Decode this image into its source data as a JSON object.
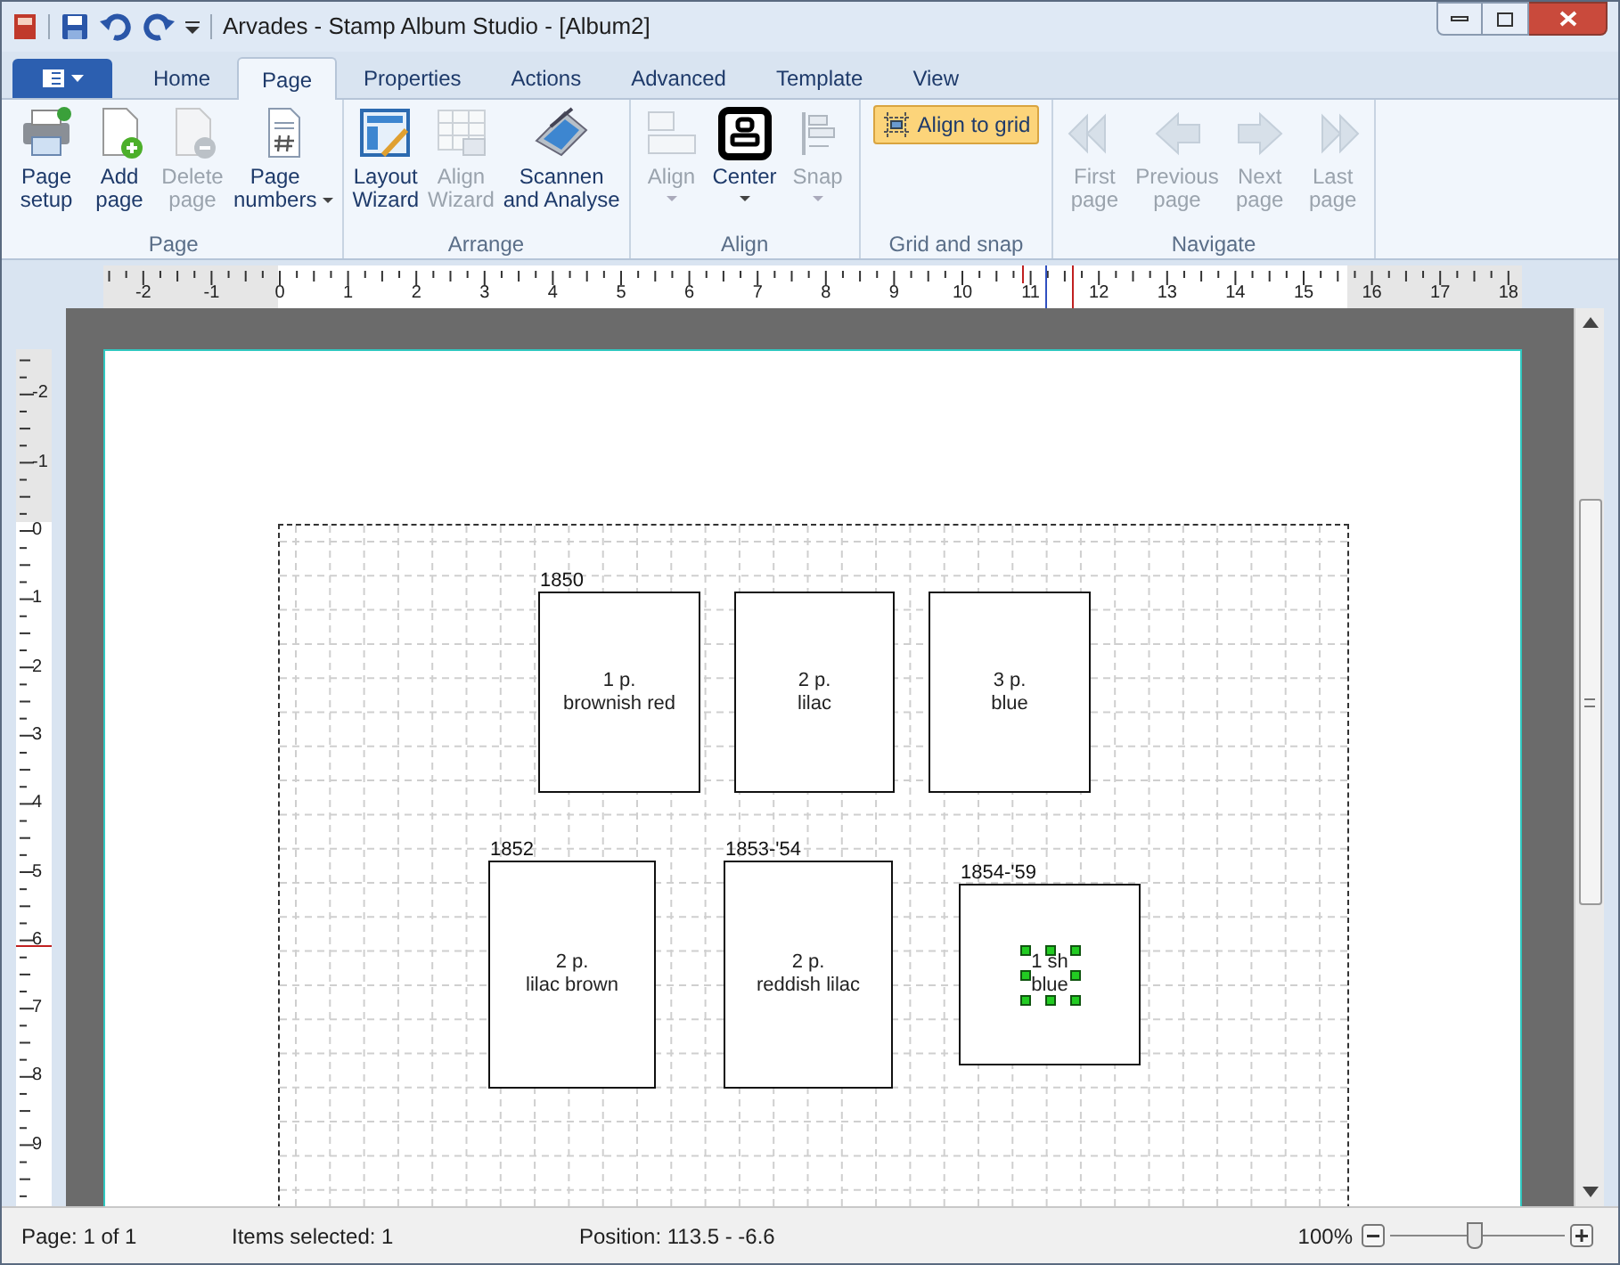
{
  "window": {
    "title": "Arvades - Stamp Album Studio - [Album2]"
  },
  "tabs": [
    {
      "label": "Home",
      "selected": false
    },
    {
      "label": "Page",
      "selected": true
    },
    {
      "label": "Properties",
      "selected": false
    },
    {
      "label": "Actions",
      "selected": false
    },
    {
      "label": "Advanced",
      "selected": false
    },
    {
      "label": "Template",
      "selected": false
    },
    {
      "label": "View",
      "selected": false
    }
  ],
  "ribbon_groups": [
    {
      "label": "Page",
      "commands": [
        {
          "label": "Page setup",
          "disabled": false,
          "dropdown": false
        },
        {
          "label": "Add page",
          "disabled": false,
          "dropdown": false
        },
        {
          "label": "Delete page",
          "disabled": true,
          "dropdown": false
        },
        {
          "label": "Page numbers",
          "disabled": false,
          "dropdown": true
        }
      ]
    },
    {
      "label": "Arrange",
      "commands": [
        {
          "label": "Layout Wizard",
          "disabled": false,
          "dropdown": false
        },
        {
          "label": "Align Wizard",
          "disabled": true,
          "dropdown": false
        },
        {
          "label": "Scannen and Analyse",
          "disabled": false,
          "dropdown": false
        }
      ]
    },
    {
      "label": "Align",
      "commands": [
        {
          "label": "Align",
          "disabled": true,
          "dropdown": true
        },
        {
          "label": "Center",
          "disabled": false,
          "dropdown": true
        },
        {
          "label": "Snap",
          "disabled": true,
          "dropdown": true
        }
      ]
    },
    {
      "label": "Grid and snap",
      "toggle": {
        "label": "Align to grid",
        "on": true
      }
    },
    {
      "label": "Navigate",
      "commands": [
        {
          "label": "First page",
          "disabled": true,
          "dropdown": false
        },
        {
          "label": "Previous page",
          "disabled": true,
          "dropdown": false
        },
        {
          "label": "Next page",
          "disabled": true,
          "dropdown": false
        },
        {
          "label": "Last page",
          "disabled": true,
          "dropdown": false
        }
      ]
    }
  ],
  "horizontal_ruler": [
    "-2",
    "-1",
    "0",
    "1",
    "2",
    "3",
    "4",
    "5",
    "6",
    "7",
    "8",
    "9",
    "10",
    "11",
    "12",
    "13",
    "14",
    "15",
    "16",
    "17",
    "18"
  ],
  "vertical_ruler": [
    "-2",
    "-1",
    "0",
    "1",
    "2",
    "3",
    "4",
    "5",
    "6",
    "7",
    "8",
    "9"
  ],
  "stamps": [
    {
      "year": "1850",
      "value": "1 p.",
      "color_name": "brownish red",
      "selected": false
    },
    {
      "value": "2 p.",
      "color_name": "lilac",
      "selected": false
    },
    {
      "value": "3 p.",
      "color_name": "blue",
      "selected": false
    },
    {
      "year": "1852",
      "value": "2 p.",
      "color_name": "lilac brown",
      "selected": false
    },
    {
      "year": "1853-'54",
      "value": "2 p.",
      "color_name": "reddish lilac",
      "selected": false
    },
    {
      "year": "1854-'59",
      "value": "1 sh",
      "color_name": "blue",
      "selected": true
    }
  ],
  "status_bar": {
    "page": "Page: 1 of 1",
    "items_selected": "Items selected: 1",
    "position": "Position: 113.5 - -6.6",
    "zoom": "100%",
    "zoom_slider": {
      "level": 0.48
    }
  }
}
